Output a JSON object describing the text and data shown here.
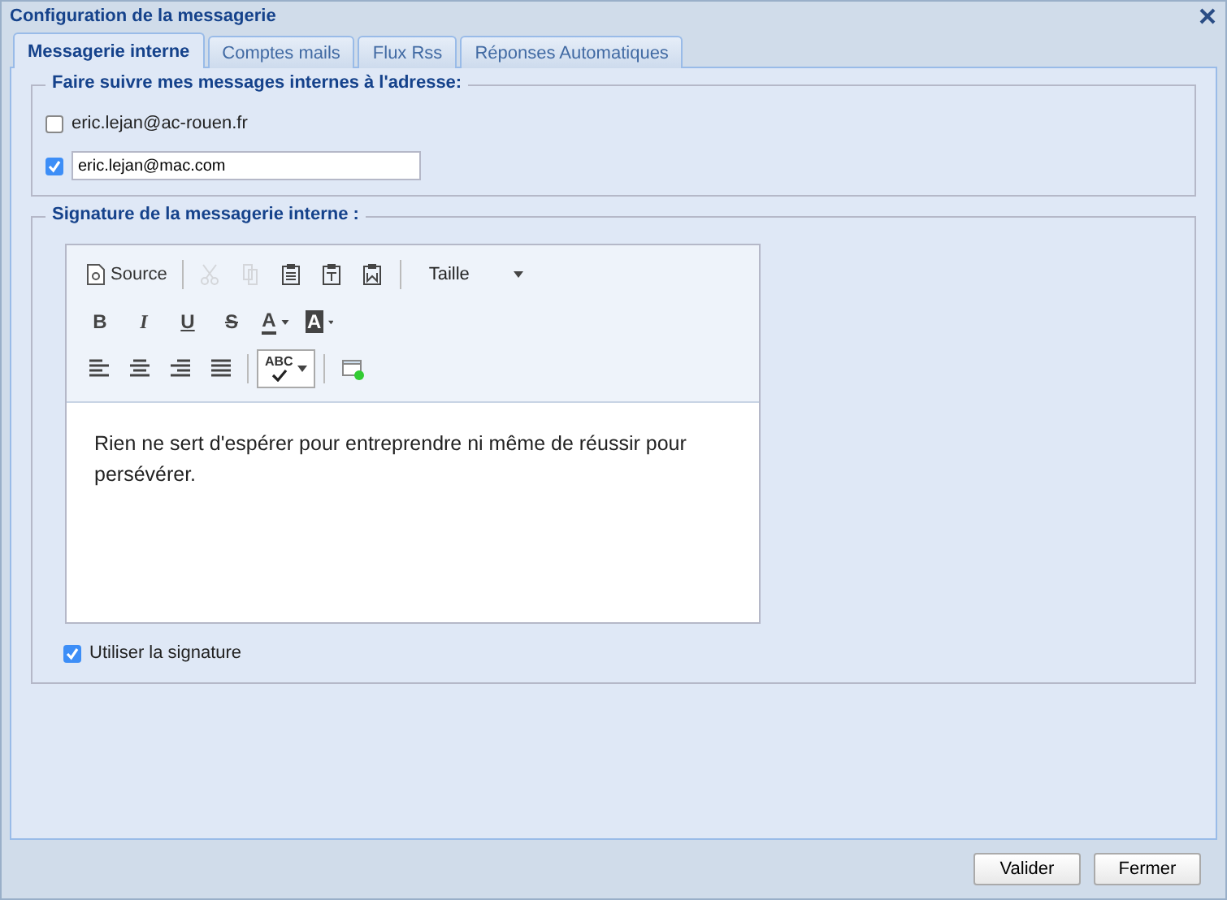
{
  "window": {
    "title": "Configuration de la messagerie"
  },
  "tabs": [
    {
      "label": "Messagerie interne",
      "selected": true
    },
    {
      "label": "Comptes mails",
      "selected": false
    },
    {
      "label": "Flux Rss",
      "selected": false
    },
    {
      "label": "Réponses Automatiques",
      "selected": false
    }
  ],
  "forward": {
    "legend": "Faire suivre mes messages internes à l'adresse:",
    "options": [
      {
        "kind": "label",
        "checked": false,
        "label": "eric.lejan@ac-rouen.fr"
      },
      {
        "kind": "input",
        "checked": true,
        "value": "eric.lejan@mac.com"
      }
    ]
  },
  "signature": {
    "legend": "Signature de la messagerie interne :",
    "toolbar": [
      [
        [
          {
            "kind": "source",
            "label": "Source",
            "disabled": false
          }
        ],
        [
          {
            "kind": "cut",
            "disabled": true
          },
          {
            "kind": "copy",
            "disabled": true
          },
          {
            "kind": "paste",
            "disabled": false
          },
          {
            "kind": "paste-text",
            "disabled": false
          },
          {
            "kind": "paste-word",
            "disabled": false
          }
        ],
        [
          {
            "kind": "select",
            "label": "Taille",
            "disabled": false
          }
        ]
      ],
      [
        [
          {
            "kind": "bold",
            "label": "B",
            "disabled": false
          },
          {
            "kind": "italic",
            "label": "I",
            "disabled": false
          },
          {
            "kind": "underline",
            "label": "U",
            "disabled": false
          },
          {
            "kind": "strike",
            "label": "S",
            "disabled": false
          },
          {
            "kind": "text-color",
            "label": "A",
            "disabled": false
          },
          {
            "kind": "bg-color",
            "label": "A",
            "disabled": false
          }
        ]
      ],
      [
        [
          {
            "kind": "align-left",
            "disabled": false
          },
          {
            "kind": "align-center",
            "disabled": false
          },
          {
            "kind": "align-right",
            "disabled": false
          },
          {
            "kind": "justify",
            "disabled": false
          }
        ],
        [
          {
            "kind": "spellcheck",
            "label": "ABC",
            "disabled": false
          }
        ],
        [
          {
            "kind": "window",
            "disabled": false
          }
        ]
      ]
    ],
    "body": "Rien ne sert d'espérer pour entreprendre ni même de réussir pour persévérer.",
    "use": {
      "label": "Utiliser la signature",
      "checked": true
    }
  },
  "buttons": [
    "Valider",
    "Fermer"
  ]
}
